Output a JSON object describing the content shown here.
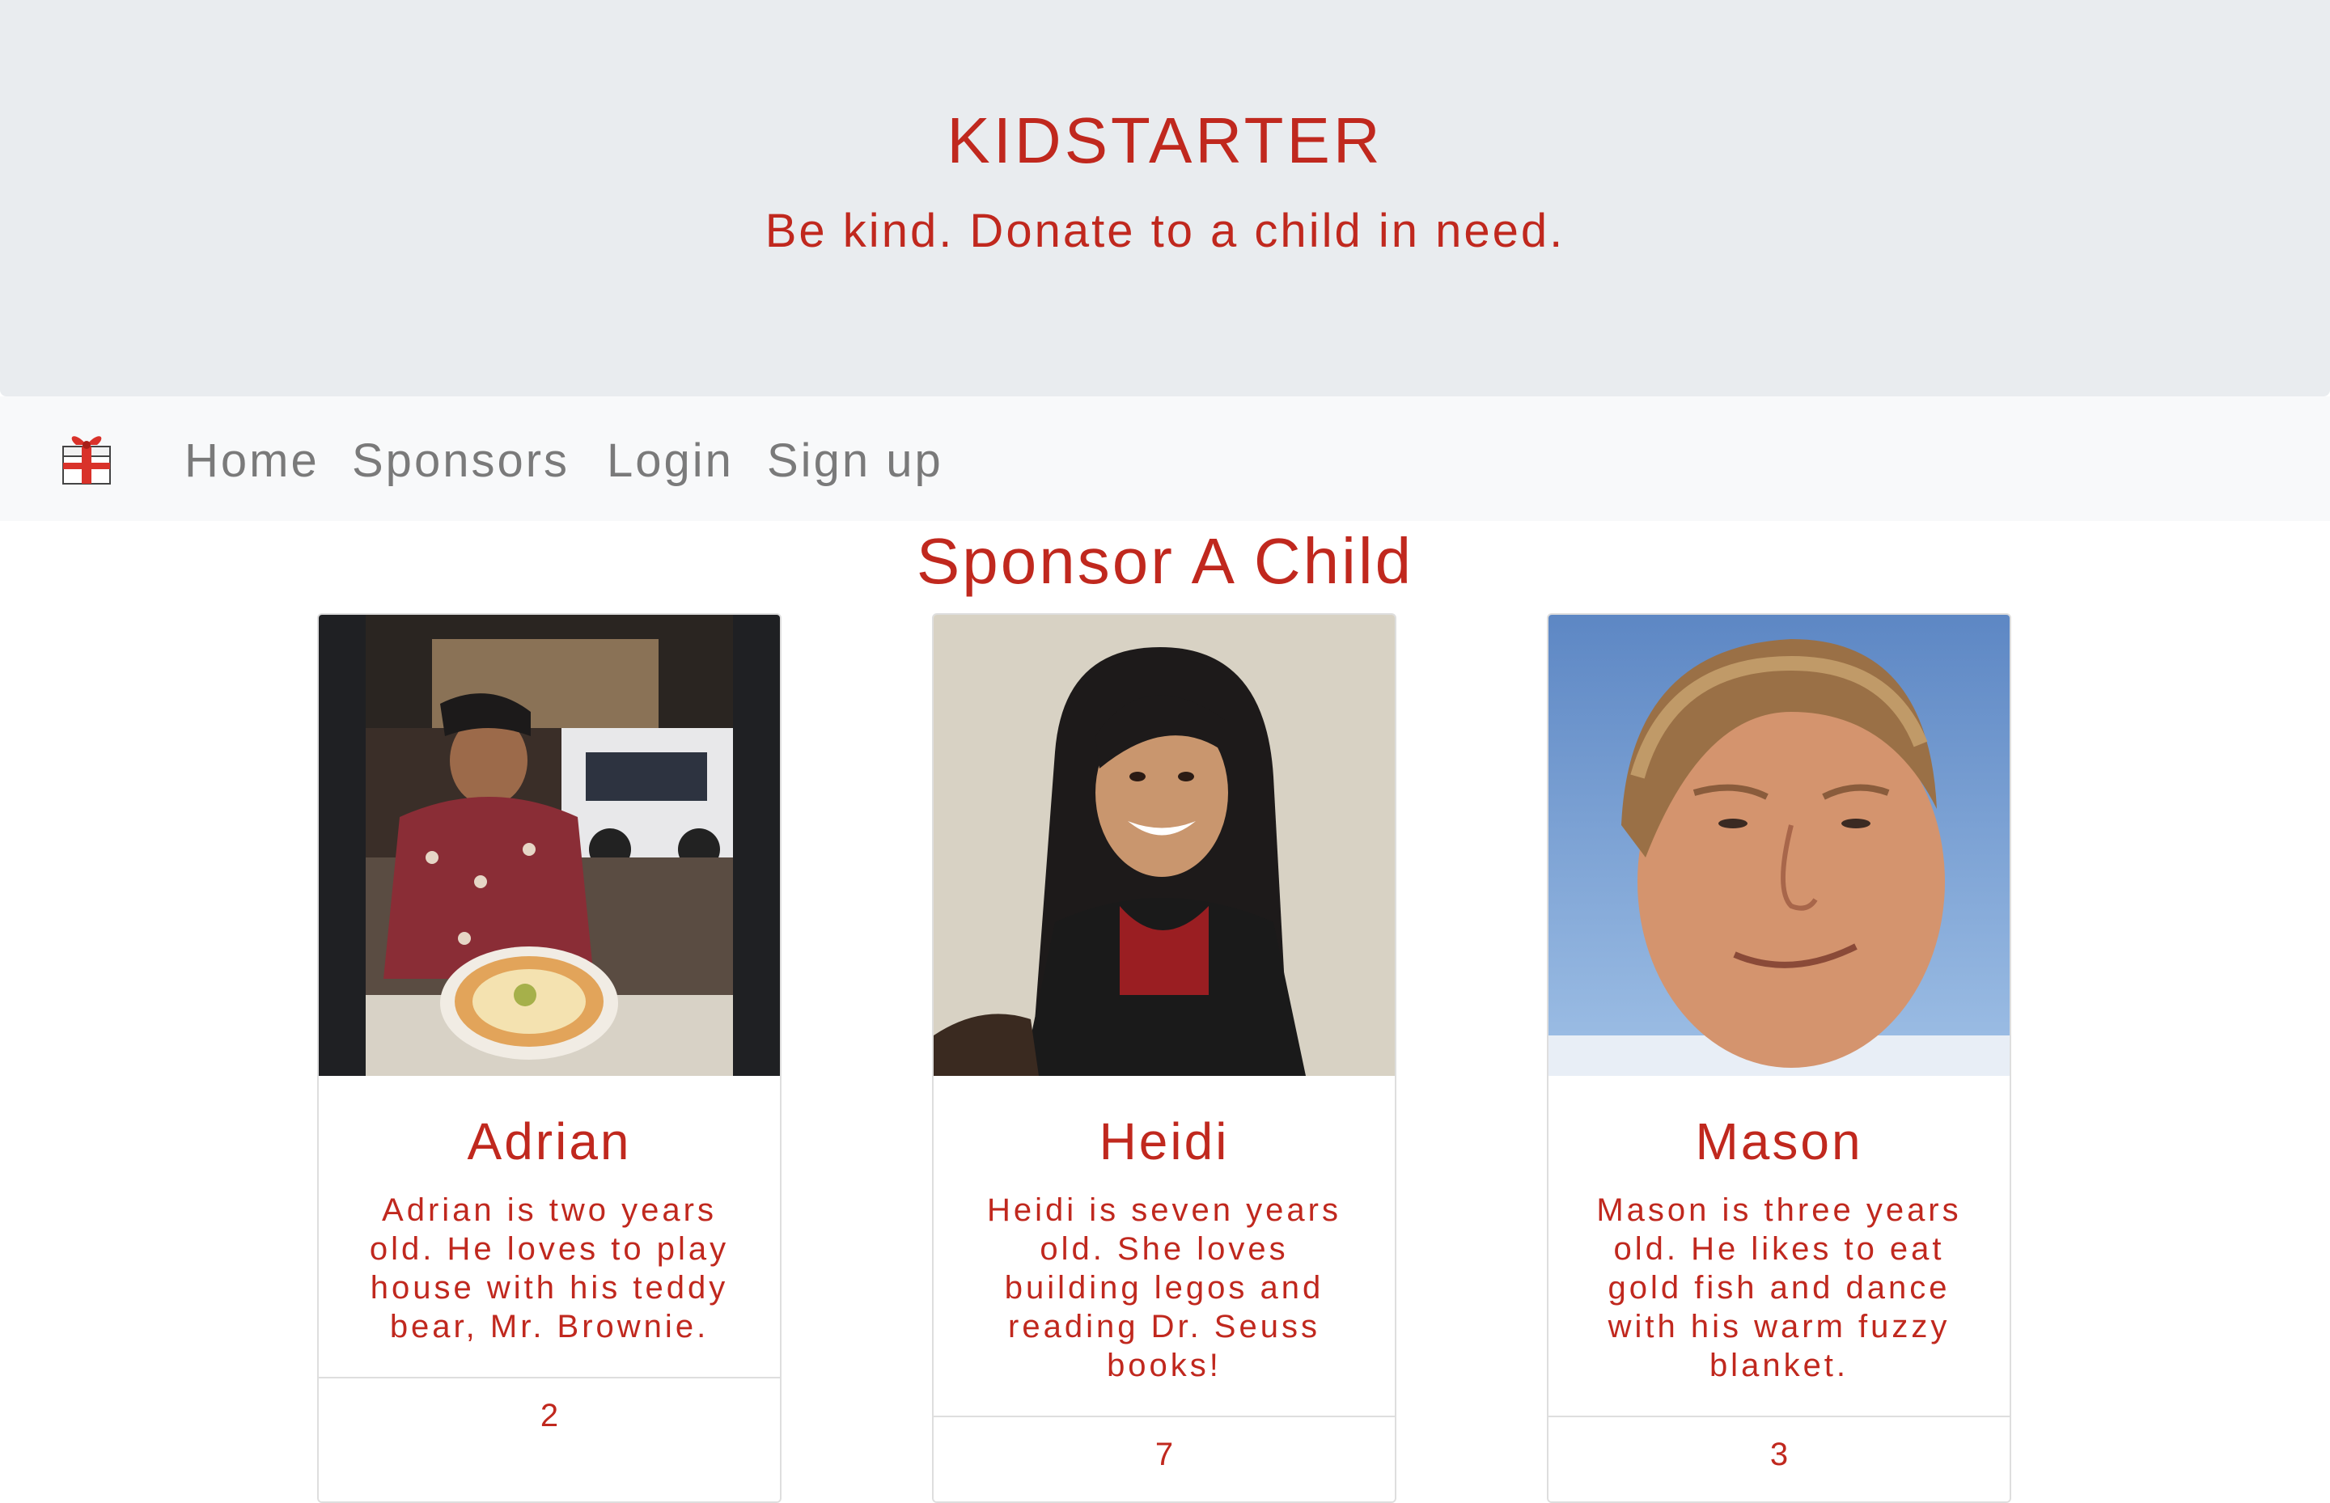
{
  "header": {
    "title": "KIDSTARTER",
    "tagline": "Be kind. Donate to a child in need."
  },
  "nav": {
    "brand_icon": "gift-icon",
    "links": [
      "Home",
      "Sponsors",
      "Login",
      "Sign up"
    ]
  },
  "main": {
    "title": "Sponsor A Child",
    "children": [
      {
        "name": "Adrian",
        "description": "Adrian is two years old. He loves to play house with his teddy bear, Mr. Brownie.",
        "count": "2"
      },
      {
        "name": "Heidi",
        "description": "Heidi is seven years old. She loves building legos and reading Dr. Seuss books!",
        "count": "7"
      },
      {
        "name": "Mason",
        "description": "Mason is three years old. He likes to eat gold fish and dance with his warm fuzzy blanket.",
        "count": "3"
      }
    ]
  },
  "colors": {
    "accent": "#c0281e",
    "hero_bg": "#e9ecef",
    "nav_bg": "#f8f9fa",
    "nav_text": "#7a7a7a"
  }
}
